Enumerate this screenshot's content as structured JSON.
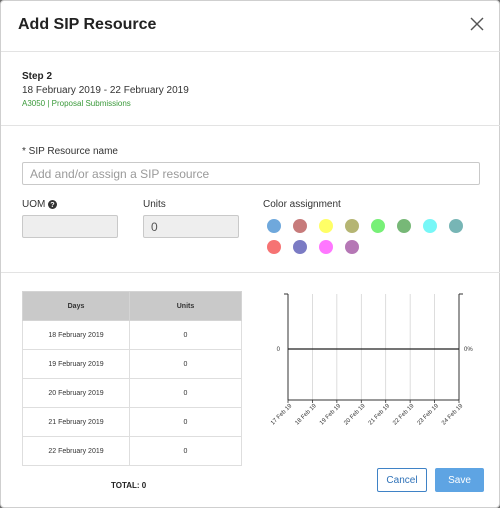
{
  "dialog": {
    "title": "Add SIP Resource",
    "close_icon": "close-icon"
  },
  "step": {
    "label": "Step 2",
    "date_range": "18 February 2019 - 22 February 2019",
    "project": "A3050 | Proposal Submissions"
  },
  "form": {
    "resource_name_label": "* SIP Resource name",
    "resource_name_placeholder": "Add and/or assign a SIP resource",
    "resource_name_value": "",
    "uom_label": "UOM",
    "uom_help_icon": "help-circle-icon",
    "uom_value": "",
    "units_label": "Units",
    "units_value": "0",
    "color_label": "Color assignment",
    "colors": [
      "#6fa8dc",
      "#c77b7b",
      "#ffff66",
      "#b5b573",
      "#77f077",
      "#77b877",
      "#77f7f7",
      "#77b5b5",
      "#f67373",
      "#7b7bc4",
      "#ff77ff",
      "#b577b5"
    ]
  },
  "table": {
    "headers": [
      "Days",
      "Units"
    ],
    "rows": [
      {
        "day": "18 February 2019",
        "units": "0"
      },
      {
        "day": "19 February 2019",
        "units": "0"
      },
      {
        "day": "20 February 2019",
        "units": "0"
      },
      {
        "day": "21 February 2019",
        "units": "0"
      },
      {
        "day": "22 February 2019",
        "units": "0"
      }
    ],
    "total": "TOTAL: 0"
  },
  "buttons": {
    "cancel": "Cancel",
    "save": "Save"
  },
  "chart_data": {
    "type": "line",
    "categories": [
      "17 Feb 19",
      "18 Feb 19",
      "19 Feb 19",
      "20 Feb 19",
      "21 Feb 19",
      "22 Feb 19",
      "23 Feb 19",
      "24 Feb 19"
    ],
    "series": [
      {
        "values": [
          0,
          0,
          0,
          0,
          0,
          0,
          0,
          0
        ]
      }
    ],
    "left_axis_label": "0",
    "right_axis_label": "0%",
    "grid": true
  }
}
